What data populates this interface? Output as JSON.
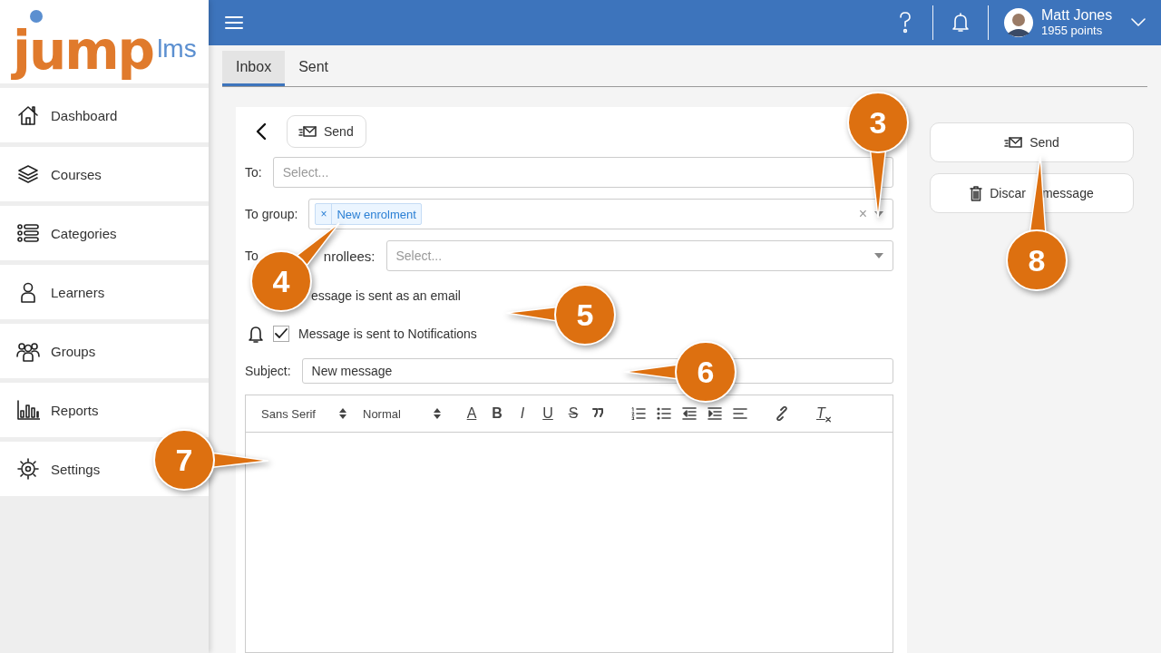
{
  "logo": {
    "primary": "jump",
    "secondary": "lms"
  },
  "sidebar": {
    "items": [
      {
        "kind": "home",
        "label": "Dashboard"
      },
      {
        "kind": "stack",
        "label": "Courses"
      },
      {
        "kind": "list",
        "label": "Categories"
      },
      {
        "kind": "person",
        "label": "Learners"
      },
      {
        "kind": "people",
        "label": "Groups"
      },
      {
        "kind": "chart",
        "label": "Reports"
      },
      {
        "kind": "gear",
        "label": "Settings"
      }
    ]
  },
  "header": {
    "user": {
      "name": "Matt Jones",
      "points": "1955 points"
    }
  },
  "tabs": [
    {
      "label": "Inbox",
      "selected": true
    },
    {
      "label": "Sent",
      "selected": false
    }
  ],
  "form": {
    "send_button": "Send",
    "to": {
      "label": "To:",
      "placeholder": "Select..."
    },
    "to_group": {
      "label": "To group:",
      "tags": [
        {
          "remove": "×",
          "label": "New enrolment"
        }
      ],
      "clear": "×"
    },
    "to_enrollees": {
      "label_parts": [
        "To",
        "nrollees:"
      ],
      "placeholder": "Select..."
    },
    "email_option": {
      "label": "essage is sent as an email"
    },
    "notification_option": {
      "label": "Message is sent to Notifications",
      "checked": true
    },
    "subject": {
      "label": "Subject:",
      "value": "New message"
    },
    "editor": {
      "toolbar": [
        {
          "kind": "picker",
          "label": "Sans Serif"
        },
        {
          "kind": "picker",
          "label": "Normal"
        },
        {
          "kind": "color",
          "text": "A"
        },
        {
          "kind": "bold",
          "text": "B"
        },
        {
          "kind": "italic",
          "text": "I"
        },
        {
          "kind": "underline",
          "text": "U"
        },
        {
          "kind": "strike",
          "text": "S"
        },
        {
          "kind": "quote"
        },
        {
          "kind": "ordered"
        },
        {
          "kind": "bullet"
        },
        {
          "kind": "outdent"
        },
        {
          "kind": "indent"
        },
        {
          "kind": "align"
        },
        {
          "kind": "link"
        },
        {
          "kind": "clean",
          "text": "T"
        }
      ]
    }
  },
  "actions": {
    "send": "Send",
    "discard_parts": [
      "Discar",
      "message"
    ]
  },
  "callouts": [
    {
      "number": "3"
    },
    {
      "number": "4"
    },
    {
      "number": "5"
    },
    {
      "number": "6"
    },
    {
      "number": "7"
    },
    {
      "number": "8"
    }
  ]
}
